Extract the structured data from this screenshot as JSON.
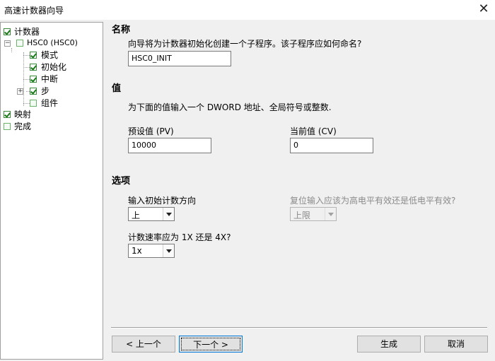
{
  "window": {
    "title": "高速计数器向导",
    "close_glyph": "✕"
  },
  "tree": {
    "counter": "计数器",
    "hsc0": "HSC0 (HSC0)",
    "mode": "模式",
    "init": "初始化",
    "interrupt": "中断",
    "step": "步",
    "component": "组件",
    "mapping": "映射",
    "finish": "完成"
  },
  "name_section": {
    "heading": "名称",
    "prompt": "向导将为计数器初始化创建一个子程序。该子程序应如何命名?",
    "value": "HSC0_INIT"
  },
  "value_section": {
    "heading": "值",
    "prompt": "为下面的值输入一个 DWORD 地址、全局符号或整数.",
    "preset_label": "预设值 (PV)",
    "preset_value": "10000",
    "current_label": "当前值 (CV)",
    "current_value": "0"
  },
  "options_section": {
    "heading": "选项",
    "direction_label": "输入初始计数方向",
    "direction_value": "上",
    "reset_label": "复位输入应该为高电平有效还是低电平有效?",
    "reset_value": "上限",
    "rate_label": "计数速率应为 1X 还是 4X?",
    "rate_value": "1x"
  },
  "buttons": {
    "prev": "< 上一个",
    "next": "下一个 >",
    "generate": "生成",
    "cancel": "取消"
  }
}
